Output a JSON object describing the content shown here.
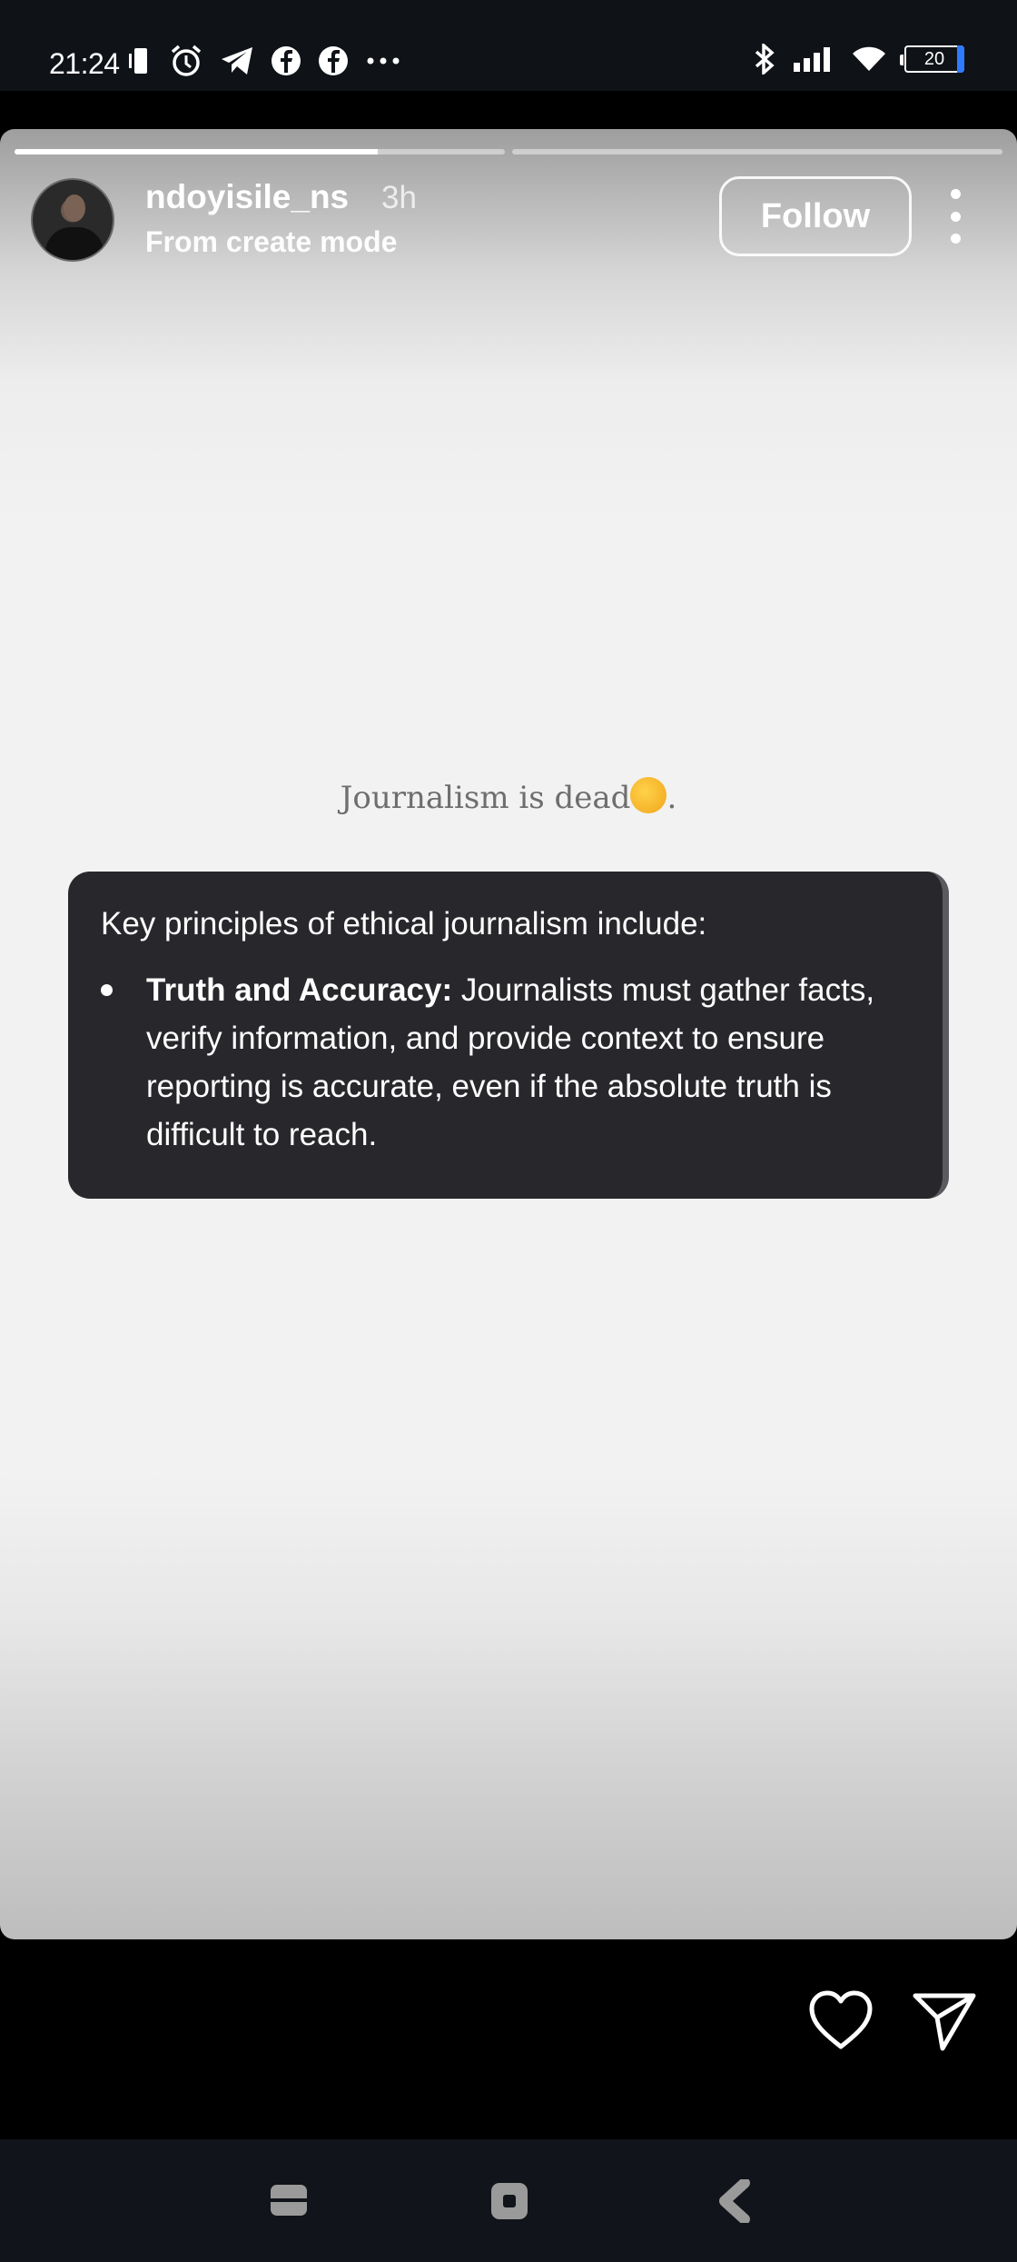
{
  "status_bar": {
    "time": "21:24",
    "battery": "20",
    "left_icons": [
      "vibrate-icon",
      "alarm-icon",
      "telegram-icon",
      "facebook-icon",
      "facebook-icon",
      "more-dots-icon"
    ],
    "right_icons": [
      "bluetooth-icon",
      "signal-icon",
      "wifi-icon",
      "battery-icon"
    ]
  },
  "story": {
    "progress": [
      0.74,
      0.0
    ],
    "username": "ndoyisile_ns",
    "time_ago": "3h",
    "subtitle": "From create mode",
    "follow_label": "Follow",
    "headline": "Journalism is dead",
    "headline_suffix": ".",
    "card": {
      "intro": "Key principles of ethical journalism include:",
      "items": [
        {
          "title": "Truth and Accuracy:",
          "text": " Journalists must gather facts, verify information, and provide context to ensure reporting is accurate, even if the absolute truth is difficult to reach."
        }
      ]
    }
  },
  "actions": {
    "icons": [
      "heart-icon",
      "send-icon"
    ]
  },
  "navbar": {
    "icons": [
      "recent-apps-icon",
      "home-icon",
      "back-icon"
    ]
  },
  "colors": {
    "card_bg": "#28282c",
    "story_bg": "#f2f2f2",
    "status_bg": "#0f1217",
    "emoji": "#f5b82e"
  }
}
